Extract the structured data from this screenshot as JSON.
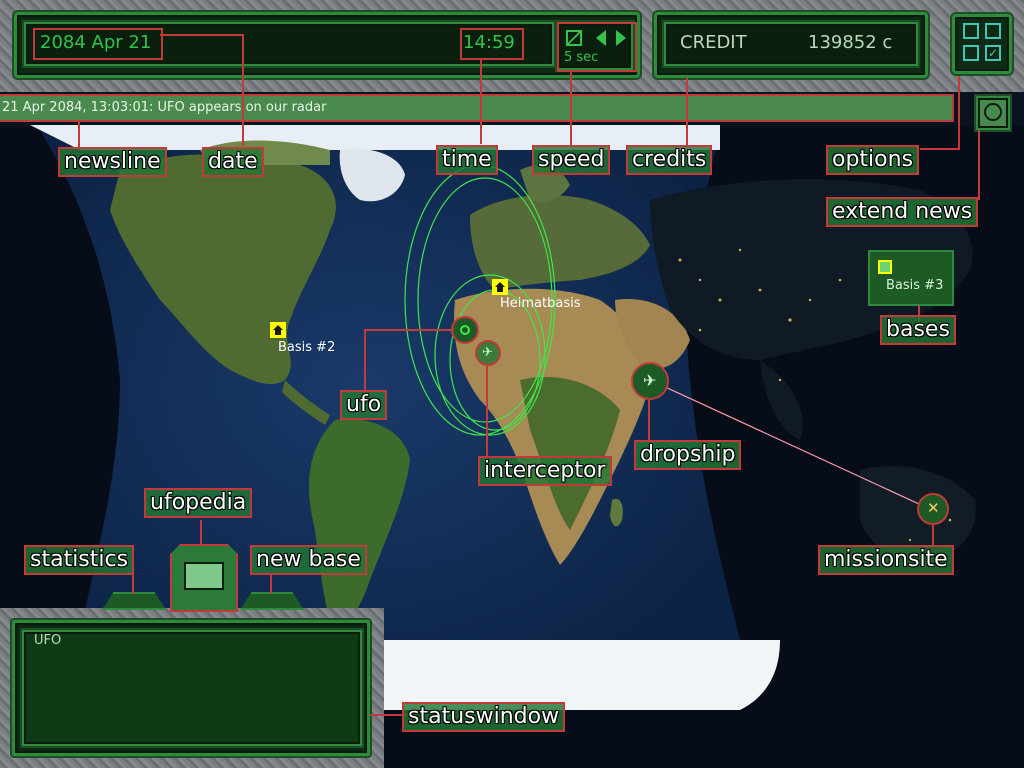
{
  "date": "2084 Apr 21",
  "time": "14:59",
  "speed": "5 sec",
  "credit": {
    "label": "CREDIT",
    "value": "139852 c"
  },
  "newsline": "21 Apr 2084, 13:03:01: UFO appears on our radar",
  "status_window": {
    "title": "UFO"
  },
  "bases": [
    {
      "name": "Heimatbasis"
    },
    {
      "name": "Basis #2"
    },
    {
      "name": "Basis #3"
    }
  ],
  "annotations": {
    "newsline": "newsline",
    "date": "date",
    "time": "time",
    "speed": "speed",
    "credits": "credits",
    "options": "options",
    "extend_news": "extend news",
    "bases": "bases",
    "ufo": "ufo",
    "interceptor": "interceptor",
    "dropship": "dropship",
    "missionsite": "missionsite",
    "ufopedia": "ufopedia",
    "statistics": "statistics",
    "new_base": "new base",
    "statuswindow": "statuswindow"
  },
  "colors": {
    "hud_green": "#34c24a",
    "panel_bg": "#0f2a14",
    "annotation_red": "#c23a3a",
    "base_marker": "#ffff00"
  },
  "icons": [
    "options-icon",
    "extend-news-icon",
    "ufopedia-icon",
    "speed-stop-icon",
    "speed-down-icon",
    "speed-up-icon",
    "base-icon",
    "ufo-icon",
    "interceptor-icon",
    "dropship-icon",
    "missionsite-icon"
  ]
}
